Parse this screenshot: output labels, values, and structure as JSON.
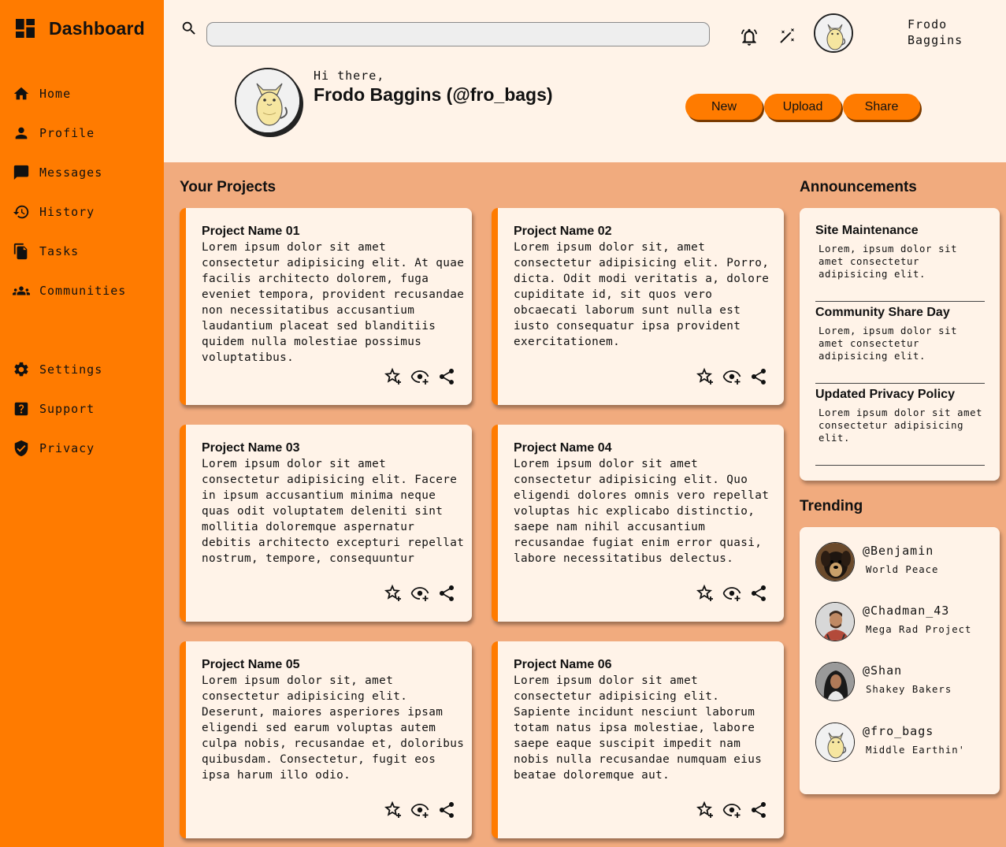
{
  "sidebar": {
    "title": "Dashboard",
    "items": [
      {
        "label": "Home",
        "icon": "home-icon"
      },
      {
        "label": "Profile",
        "icon": "person-icon"
      },
      {
        "label": "Messages",
        "icon": "chat-icon"
      },
      {
        "label": "History",
        "icon": "history-icon"
      },
      {
        "label": "Tasks",
        "icon": "documents-icon"
      },
      {
        "label": "Communities",
        "icon": "group-icon"
      },
      {
        "label": "Settings",
        "icon": "gear-icon"
      },
      {
        "label": "Support",
        "icon": "help-icon"
      },
      {
        "label": "Privacy",
        "icon": "shield-icon"
      }
    ]
  },
  "header": {
    "search": {
      "value": "",
      "placeholder": ""
    },
    "user_first": "Frodo",
    "user_last": "Baggins",
    "greeting": "Hi there,",
    "full_name": "Frodo Baggins (@fro_bags)",
    "buttons": {
      "new": "New",
      "upload": "Upload",
      "share": "Share"
    }
  },
  "projects": {
    "title": "Your Projects",
    "cards": [
      {
        "title": "Project Name 01",
        "body": "Lorem ipsum dolor sit amet consectetur adipisicing elit. At quae facilis architecto dolorem, fuga eveniet tempora, provident recusandae non necessitatibus accusantium laudantium placeat sed blanditiis quidem nulla molestiae possimus voluptatibus."
      },
      {
        "title": "Project Name 02",
        "body": "Lorem ipsum dolor sit, amet consectetur adipisicing elit. Porro, dicta. Odit modi veritatis a, dolore cupiditate id, sit quos vero obcaecati laborum sunt nulla est iusto consequatur ipsa provident exercitationem."
      },
      {
        "title": "Project Name 03",
        "body": "Lorem ipsum dolor sit amet consectetur adipisicing elit. Facere in ipsum accusantium minima neque quas odit voluptatem deleniti sint mollitia doloremque aspernatur debitis architecto excepturi repellat nostrum, tempore, consequuntur"
      },
      {
        "title": "Project Name 04",
        "body": "Lorem ipsum dolor sit amet consectetur adipisicing elit. Quo eligendi dolores omnis vero repellat voluptas hic explicabo distinctio, saepe nam nihil accusantium recusandae fugiat enim error quasi, labore necessitatibus delectus."
      },
      {
        "title": "Project Name 05",
        "body": "Lorem ipsum dolor sit, amet consectetur adipisicing elit. Deserunt, maiores asperiores ipsam eligendi sed earum voluptas autem culpa nobis, recusandae et, doloribus quibusdam. Consectetur, fugit eos ipsa harum illo odio."
      },
      {
        "title": "Project Name 06",
        "body": "Lorem ipsum dolor sit amet consectetur adipisicing elit. Sapiente incidunt nesciunt laborum totam natus ipsa molestiae, labore saepe eaque suscipit impedit nam nobis nulla recusandae numquam eius beatae doloremque aut."
      }
    ]
  },
  "announcements": {
    "title": "Announcements",
    "items": [
      {
        "title": "Site Maintenance",
        "body": "Lorem, ipsum dolor sit amet consectetur adipisicing elit."
      },
      {
        "title": "Community Share Day",
        "body": "Lorem, ipsum dolor sit amet consectetur adipisicing elit."
      },
      {
        "title": "Updated Privacy Policy",
        "body": "Lorem ipsum dolor sit amet consectetur adipisicing elit."
      }
    ]
  },
  "trending": {
    "title": "Trending",
    "items": [
      {
        "handle": "@Benjamin",
        "subtitle": "World Peace"
      },
      {
        "handle": "@Chadman_43",
        "subtitle": "Mega Rad Project"
      },
      {
        "handle": "@Shan",
        "subtitle": "Shakey Bakers"
      },
      {
        "handle": "@fro_bags",
        "subtitle": "Middle Earthin'"
      }
    ]
  },
  "colors": {
    "accent": "#ff7b00",
    "background": "#f1ab7e",
    "surface": "#fff3e8"
  }
}
